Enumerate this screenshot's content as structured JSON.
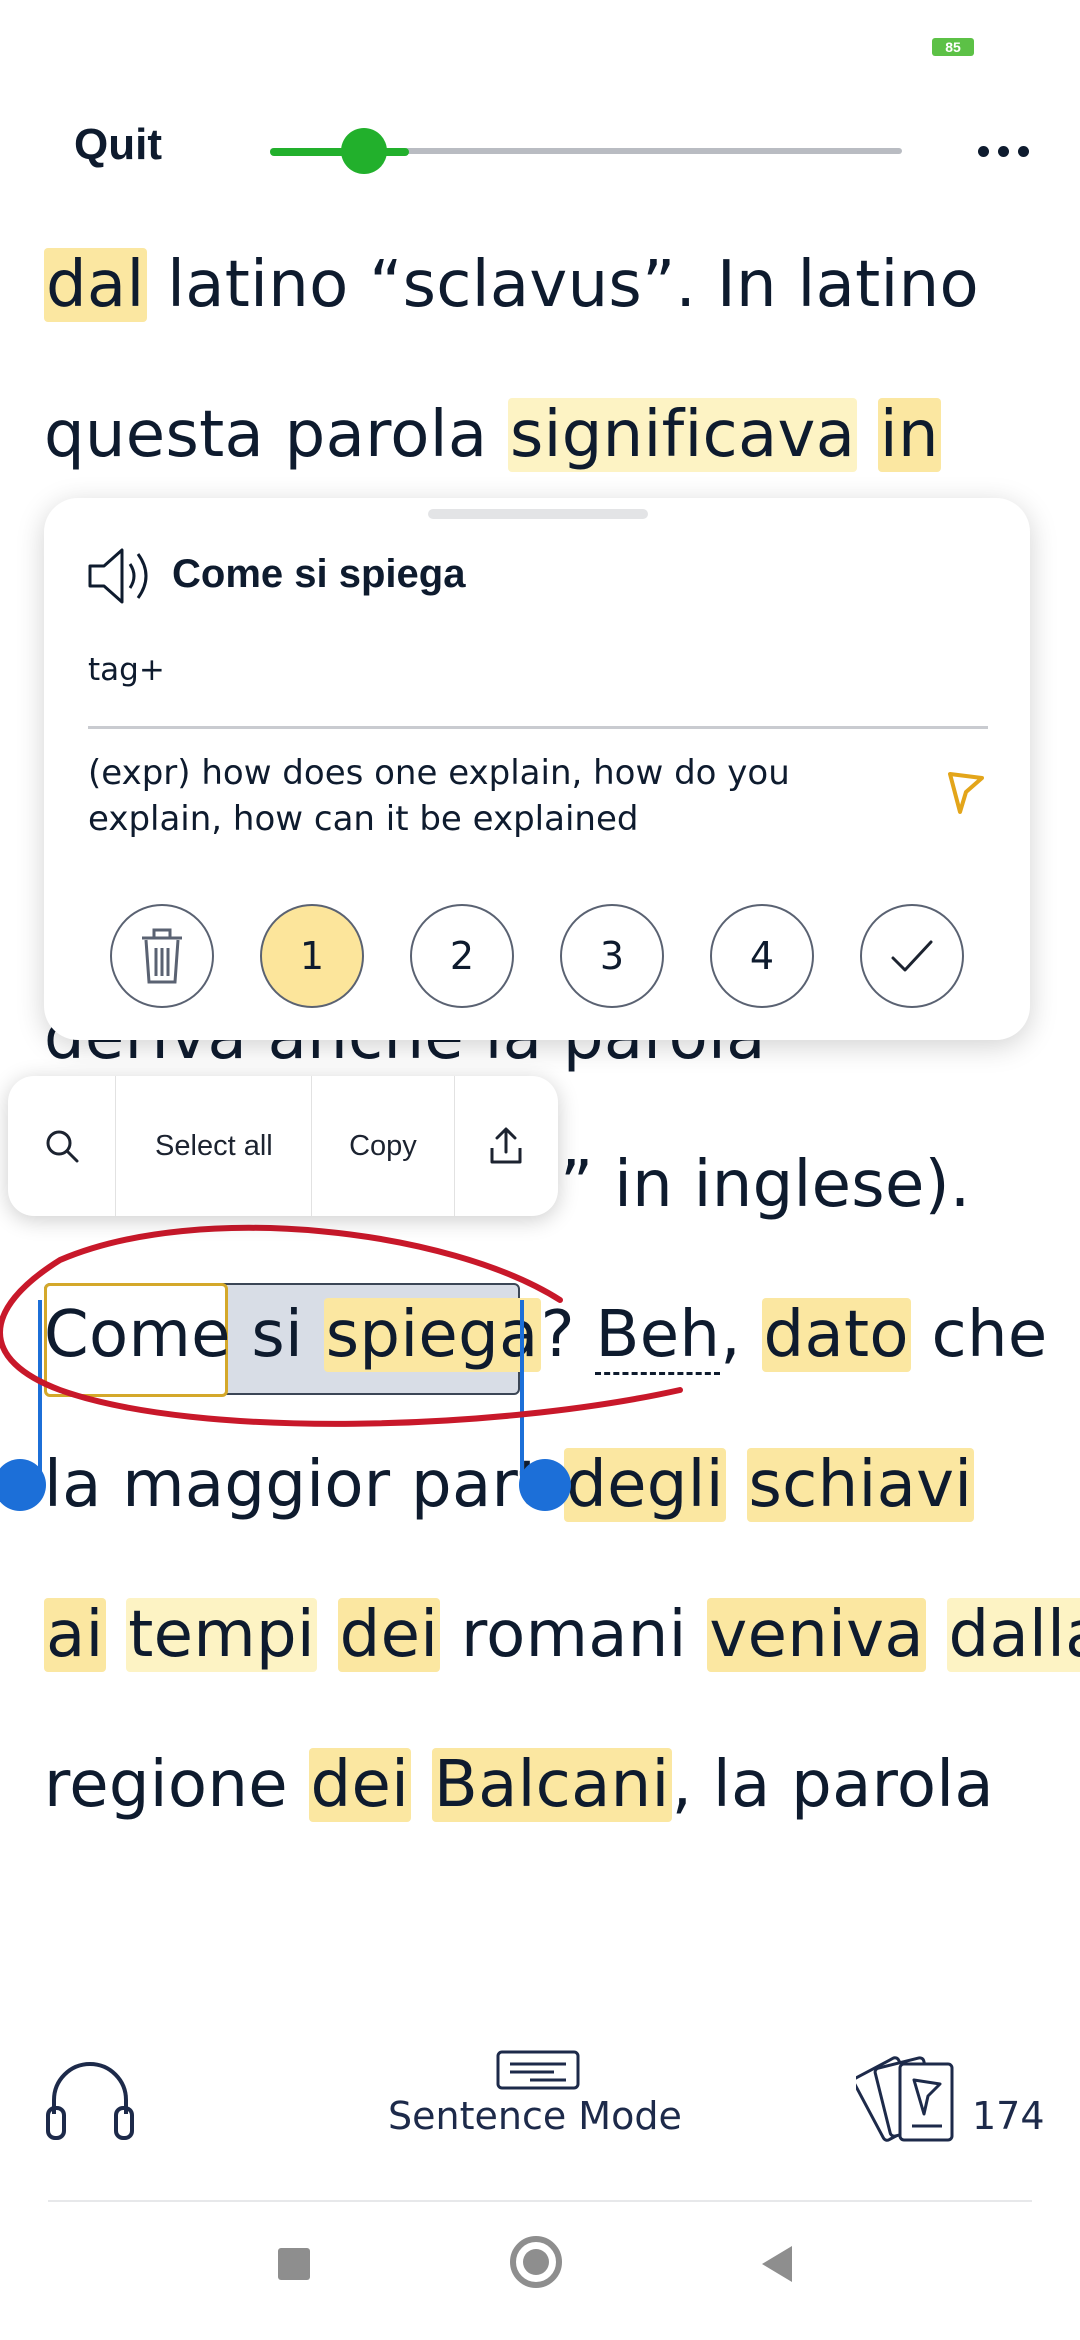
{
  "status": {
    "battery": "85"
  },
  "header": {
    "quit_label": "Quit",
    "progress": 0.22
  },
  "reading": {
    "line1": {
      "w1": "dal",
      "w2": " latino “sclavus”. In latino"
    },
    "line2": {
      "w1": "questa parola ",
      "w2": "significava",
      "w3": " ",
      "w4": "in"
    },
    "line3": {
      "w1": "deriva anche la parola"
    },
    "line4": {
      "w1": "” in inglese)."
    },
    "line5": {
      "w1": "Come",
      "w2": " si ",
      "w3": "spiega",
      "w4": "?  ",
      "w5": "Beh",
      "w6": ", ",
      "w7": "dato",
      "w8": " che"
    },
    "line6": {
      "w1": "la maggior part",
      "w2": " ",
      "w3": "degli",
      "w4": " ",
      "w5": "schiavi"
    },
    "line7": {
      "w1": "ai",
      "w2": " ",
      "w3": "tempi",
      "w4": " ",
      "w5": "dei",
      "w6": " romani ",
      "w7": "veniva",
      "w8": " ",
      "w9": "dalla"
    },
    "line8": {
      "w1": "regione ",
      "w2": "dei",
      "w3": " ",
      "w4": "Balcani",
      "w5": ", la parola"
    }
  },
  "popup": {
    "title": "Come si spiega",
    "tag": "tag+",
    "meaning": "(expr) how does one explain, how do you explain, how can it be explained",
    "levels": [
      "1",
      "2",
      "3",
      "4"
    ],
    "selected_level": "1"
  },
  "context_menu": {
    "select_all": "Select all",
    "copy": "Copy"
  },
  "bottom": {
    "sentence_mode": "Sentence Mode",
    "card_count": "174"
  },
  "colors": {
    "accent_green": "#22b02c",
    "highlight": "#fbe7a1",
    "annotation_red": "#c8182a"
  }
}
